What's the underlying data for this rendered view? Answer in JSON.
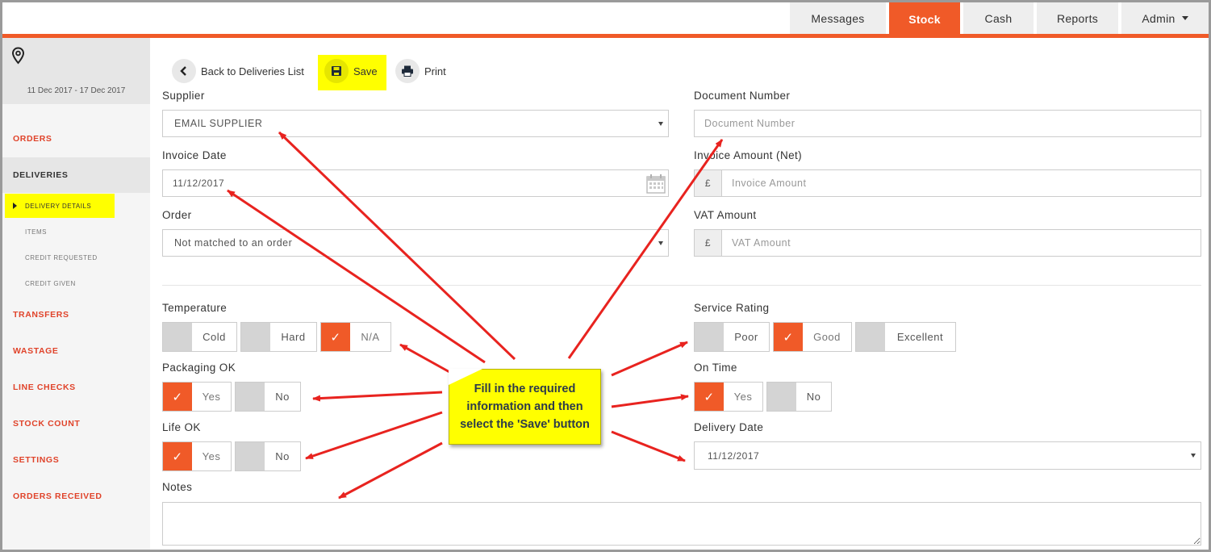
{
  "nav": {
    "tabs": [
      {
        "label": "Messages"
      },
      {
        "label": "Stock"
      },
      {
        "label": "Cash"
      },
      {
        "label": "Reports"
      },
      {
        "label": "Admin"
      }
    ],
    "active": "Stock"
  },
  "sidebar": {
    "location_icon": "map-pin-icon",
    "date_range": "11 Dec 2017 - 17 Dec 2017",
    "items": [
      {
        "label": "ORDERS"
      },
      {
        "label": "DELIVERIES"
      },
      {
        "label": "TRANSFERS"
      },
      {
        "label": "WASTAGE"
      },
      {
        "label": "LINE CHECKS"
      },
      {
        "label": "STOCK COUNT"
      },
      {
        "label": "SETTINGS"
      },
      {
        "label": "ORDERS RECEIVED"
      }
    ],
    "sub_items": [
      {
        "label": "DELIVERY DETAILS"
      },
      {
        "label": "ITEMS"
      },
      {
        "label": "CREDIT REQUESTED"
      },
      {
        "label": "CREDIT GIVEN"
      }
    ]
  },
  "toolbar": {
    "back_label": "Back to Deliveries List",
    "save_label": "Save",
    "print_label": "Print"
  },
  "form": {
    "supplier_label": "Supplier",
    "supplier_value": "EMAIL SUPPLIER",
    "document_label": "Document Number",
    "document_placeholder": "Document Number",
    "invoice_date_label": "Invoice Date",
    "invoice_date_value": "11/12/2017",
    "invoice_amount_label": "Invoice Amount (Net)",
    "invoice_amount_placeholder": "Invoice Amount",
    "currency": "£",
    "order_label": "Order",
    "order_value": "Not matched to an order",
    "vat_label": "VAT Amount",
    "vat_placeholder": "VAT Amount",
    "temperature_label": "Temperature",
    "temperature_options": [
      "Cold",
      "Hard",
      "N/A"
    ],
    "temperature_selected": "N/A",
    "service_label": "Service Rating",
    "service_options": [
      "Poor",
      "Good",
      "Excellent"
    ],
    "service_selected": "Good",
    "packaging_label": "Packaging OK",
    "ontime_label": "On Time",
    "life_label": "Life OK",
    "yes": "Yes",
    "no": "No",
    "delivery_date_label": "Delivery Date",
    "delivery_date_value": "11/12/2017",
    "notes_label": "Notes",
    "check": "✓"
  },
  "callout": {
    "text": "Fill in the required information and then select the 'Save' button"
  },
  "colors": {
    "accent": "#f05a28",
    "highlight": "#ffff00",
    "arrow": "#e8231f"
  }
}
